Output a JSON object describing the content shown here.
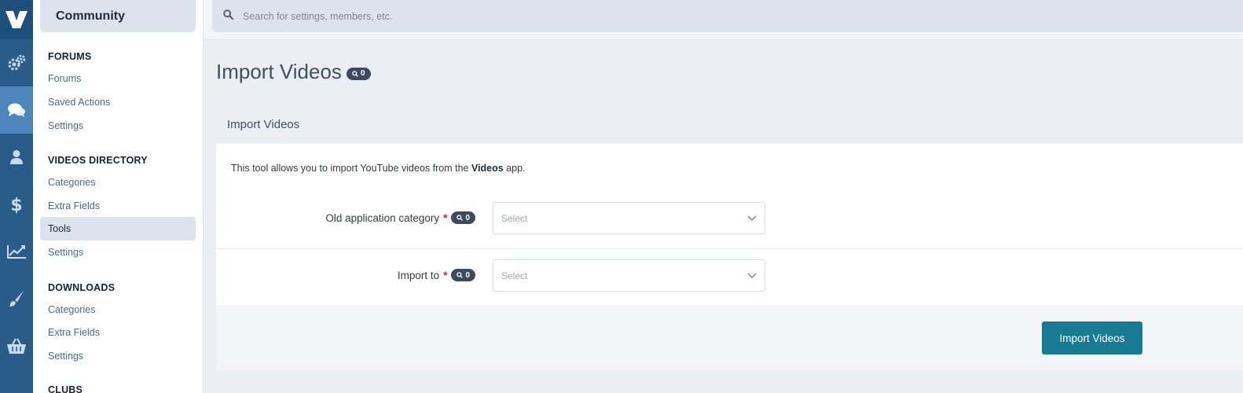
{
  "rail": {
    "items": [
      "logo-icon",
      "gears-icon",
      "comments-icon",
      "user-icon",
      "dollar-icon",
      "chart-icon",
      "brush-icon",
      "basket-icon"
    ],
    "active": "comments-icon"
  },
  "sidebar": {
    "header": "Community",
    "sections": [
      {
        "title": "FORUMS",
        "items": [
          "Forums",
          "Saved Actions",
          "Settings"
        ]
      },
      {
        "title": "VIDEOS DIRECTORY",
        "items": [
          "Categories",
          "Extra Fields",
          "Tools",
          "Settings"
        ]
      },
      {
        "title": "DOWNLOADS",
        "items": [
          "Categories",
          "Extra Fields",
          "Settings"
        ]
      },
      {
        "title": "CLUBS",
        "items": []
      }
    ],
    "active_item": "Tools"
  },
  "search": {
    "placeholder": "Search for settings, members, etc."
  },
  "page": {
    "title": "Import Videos",
    "title_badge": "0"
  },
  "panel": {
    "title": "Import Videos",
    "description_prefix": "This tool allows you to import YouTube videos from the ",
    "description_bold": "Videos",
    "description_suffix": " app.",
    "fields": [
      {
        "label": "Old application category",
        "required_mark": "*",
        "badge": "0",
        "value": "Select"
      },
      {
        "label": "Import to",
        "required_mark": "*",
        "badge": "0",
        "value": "Select"
      }
    ],
    "submit_label": "Import Videos"
  },
  "colors": {
    "rail": "#2a5c8a",
    "rail_active": "#4c86bd",
    "button": "#177b94",
    "badge": "#3e4a5e",
    "required": "#c0272d"
  }
}
